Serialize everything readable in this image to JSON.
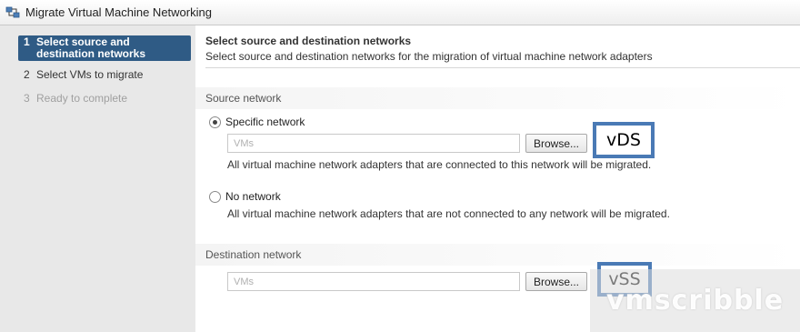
{
  "window": {
    "title": "Migrate Virtual Machine Networking",
    "icon": "network-migrate-icon"
  },
  "nav": {
    "steps": [
      {
        "num": "1",
        "label": "Select source and destination networks",
        "state": "active"
      },
      {
        "num": "2",
        "label": "Select VMs to migrate",
        "state": "enabled"
      },
      {
        "num": "3",
        "label": "Ready to complete",
        "state": "disabled"
      }
    ]
  },
  "main": {
    "title": "Select source and destination networks",
    "subtitle": "Select source and destination networks for the migration of virtual machine network adapters",
    "source": {
      "section_label": "Source network",
      "specific": {
        "label": "Specific network",
        "checked": true,
        "input_placeholder": "VMs",
        "browse_label": "Browse...",
        "helper": "All virtual machine network adapters that are connected to this network will be migrated."
      },
      "none": {
        "label": "No network",
        "checked": false,
        "helper": "All virtual machine network adapters that are not connected to any network will be migrated."
      }
    },
    "destination": {
      "section_label": "Destination network",
      "input_placeholder": "VMs",
      "browse_label": "Browse..."
    }
  },
  "annotations": {
    "source_callout": "vDS",
    "destination_callout": "vSS",
    "callout_border_color": "#4a7ab5"
  },
  "watermark": "vmscribble",
  "colors": {
    "nav_active_bg": "#2f5b85",
    "nav_bg": "#e8e8e8"
  }
}
